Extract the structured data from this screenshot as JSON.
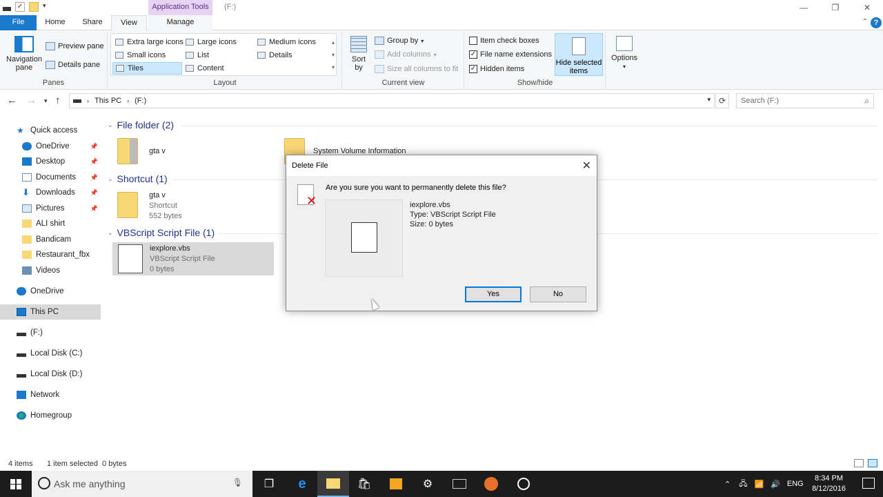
{
  "titlebar": {
    "context_tab": "Application Tools",
    "title": "(F:)"
  },
  "tabs": {
    "file": "File",
    "home": "Home",
    "share": "Share",
    "view": "View",
    "manage": "Manage"
  },
  "ribbon": {
    "panes": {
      "navigation_pane": "Navigation pane",
      "preview_pane": "Preview pane",
      "details_pane": "Details pane",
      "group_label": "Panes"
    },
    "layout": {
      "group_label": "Layout",
      "items": [
        "Extra large icons",
        "Large icons",
        "Medium icons",
        "Small icons",
        "List",
        "Details",
        "Tiles",
        "Content"
      ],
      "selected": "Tiles"
    },
    "current_view": {
      "sort_by": "Sort by",
      "group_by": "Group by",
      "add_columns": "Add columns",
      "size_columns": "Size all columns to fit",
      "group_label": "Current view"
    },
    "show_hide": {
      "item_check_boxes": "Item check boxes",
      "item_check_boxes_checked": false,
      "file_name_extensions": "File name extensions",
      "file_name_extensions_checked": true,
      "hidden_items": "Hidden items",
      "hidden_items_checked": true,
      "hide_selected": "Hide selected items",
      "group_label": "Show/hide"
    },
    "options": "Options"
  },
  "address": {
    "path": [
      "This PC",
      "(F:)"
    ],
    "search_placeholder": "Search (F:)"
  },
  "nav": {
    "items": [
      {
        "label": "Quick access",
        "icon": "star-icon"
      },
      {
        "label": "OneDrive",
        "icon": "cloud-icon",
        "pinned": true
      },
      {
        "label": "Desktop",
        "icon": "desktop-icon",
        "pinned": true
      },
      {
        "label": "Documents",
        "icon": "documents-icon",
        "pinned": true
      },
      {
        "label": "Downloads",
        "icon": "download-icon",
        "pinned": true
      },
      {
        "label": "Pictures",
        "icon": "pictures-icon",
        "pinned": true
      },
      {
        "label": "ALI shirt",
        "icon": "folder-icon"
      },
      {
        "label": "Bandicam",
        "icon": "folder-icon"
      },
      {
        "label": "Restaurant_fbx",
        "icon": "folder-icon"
      },
      {
        "label": "Videos",
        "icon": "videos-icon"
      },
      {
        "label": "OneDrive",
        "icon": "cloud-icon"
      },
      {
        "label": "This PC",
        "icon": "pc-icon"
      },
      {
        "label": "(F:)",
        "icon": "drive-icon"
      },
      {
        "label": "Local Disk (C:)",
        "icon": "drive-icon"
      },
      {
        "label": "Local Disk (D:)",
        "icon": "drive-icon"
      },
      {
        "label": "Network",
        "icon": "network-icon"
      },
      {
        "label": "Homegroup",
        "icon": "homegroup-icon"
      }
    ]
  },
  "groups": {
    "file_folder": {
      "header": "File folder (2)",
      "items": [
        {
          "name": "gta v"
        },
        {
          "name": "System Volume Information"
        }
      ]
    },
    "shortcut": {
      "header": "Shortcut (1)",
      "items": [
        {
          "name": "gta v",
          "type": "Shortcut",
          "size": "552 bytes"
        }
      ]
    },
    "vbscript": {
      "header": "VBScript Script File (1)",
      "items": [
        {
          "name": "iexplore.vbs",
          "type": "VBScript Script File",
          "size": "0 bytes"
        }
      ]
    }
  },
  "dialog": {
    "title": "Delete File",
    "question": "Are you sure you want to permanently delete this file?",
    "file_name": "iexplore.vbs",
    "file_type": "Type: VBScript Script File",
    "file_size": "Size: 0 bytes",
    "yes": "Yes",
    "no": "No"
  },
  "status": {
    "items": "4 items",
    "selected": "1 item selected",
    "size": "0 bytes"
  },
  "taskbar": {
    "search_placeholder": "Ask me anything",
    "language": "ENG",
    "time": "8:34 PM",
    "date": "8/12/2016"
  },
  "colors": {
    "accent": "#1979ca",
    "selection": "#cce8ff",
    "context_tab": "#e6d4f2",
    "group_header": "#1e3287"
  }
}
